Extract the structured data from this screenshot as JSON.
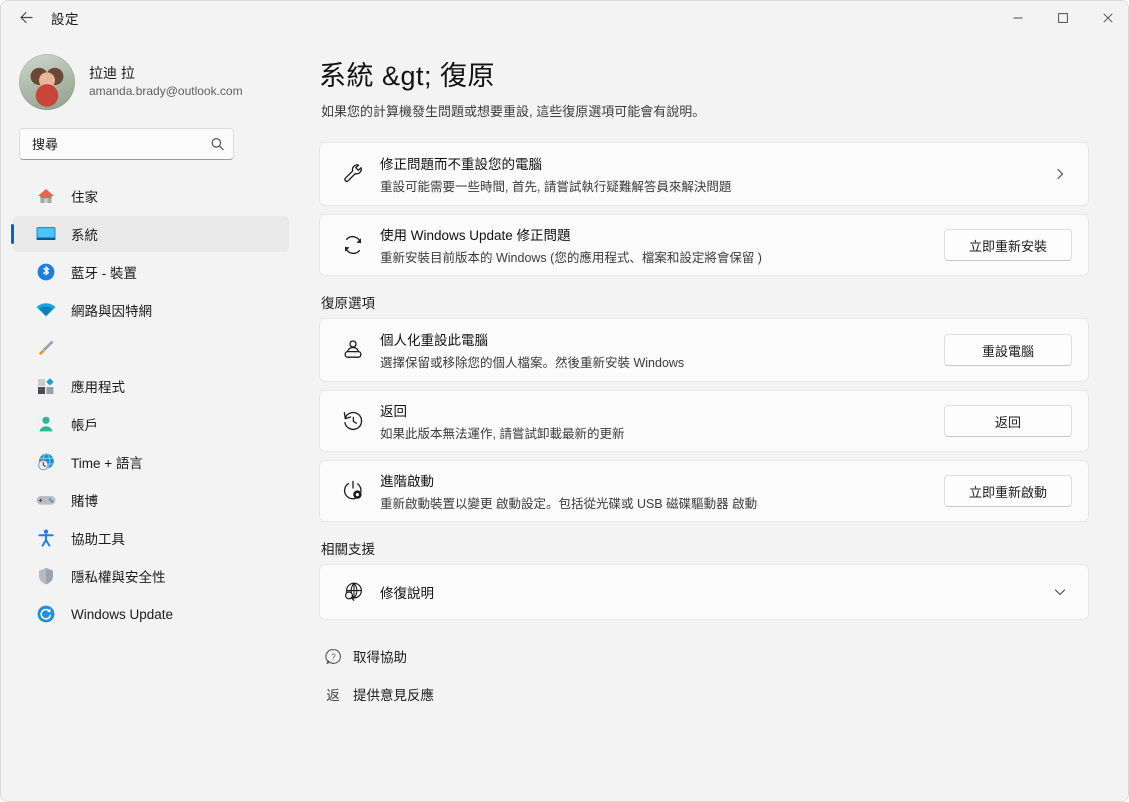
{
  "window": {
    "title": "設定",
    "back_icon": "arrow-left-icon",
    "controls": {
      "minimize": "─",
      "maximize": "□",
      "close": "✕"
    }
  },
  "sidebar": {
    "profile": {
      "name": "拉迪 拉",
      "email": "amanda.brady@outlook.com",
      "avatar": "user-avatar"
    },
    "search": {
      "placeholder": "搜尋",
      "value": "",
      "icon": "search-icon"
    },
    "items": [
      {
        "label": "住家",
        "icon": "home-icon",
        "selected": false
      },
      {
        "label": "系統",
        "icon": "monitor-icon",
        "selected": true
      },
      {
        "label": "藍牙 - 裝置",
        "icon": "bluetooth-icon",
        "selected": false
      },
      {
        "label": "網路與因特網",
        "icon": "wifi-icon",
        "selected": false
      },
      {
        "label": "",
        "icon": "paintbrush-icon",
        "selected": false
      },
      {
        "label": "應用程式",
        "icon": "apps-icon",
        "selected": false
      },
      {
        "label": "帳戶",
        "icon": "account-icon",
        "selected": false
      },
      {
        "label": "Time + 語言",
        "icon": "clock-globe-icon",
        "selected": false
      },
      {
        "label": "賭博",
        "icon": "gamepad-icon",
        "selected": false
      },
      {
        "label": "協助工具",
        "icon": "accessibility-icon",
        "selected": false
      },
      {
        "label": "隱私權與安全性",
        "icon": "shield-icon",
        "selected": false
      },
      {
        "label": "Windows Update",
        "icon": "update-icon",
        "selected": false
      }
    ]
  },
  "main": {
    "title": "系統 &gt;   復原",
    "subtitle": "如果您的計算機發生問題或想要重設, 這些復原選項可能會有說明。",
    "top_cards": [
      {
        "icon": "wrench-icon",
        "title": "修正問題而不重設您的電腦",
        "desc": "重設可能需要一些時間, 首先, 請嘗試執行疑難解答員來解決問題",
        "action_type": "chevron",
        "action_label": "›"
      },
      {
        "icon": "refresh-icon",
        "title": "使用 Windows Update 修正問題",
        "desc": "重新安裝目前版本的 Windows (您的應用程式、檔案和設定將會保留 )",
        "action_type": "button",
        "action_label": "立即重新安裝"
      }
    ],
    "recovery_section_label": "復原選項",
    "recovery_cards": [
      {
        "icon": "reset-pc-icon",
        "title": "個人化重設此電腦",
        "desc": "選擇保留或移除您的個人檔案。然後重新安裝 Windows",
        "action_type": "button",
        "action_label": "重設電腦"
      },
      {
        "icon": "history-icon",
        "title": "返回",
        "desc": "如果此版本無法運作, 請嘗試卸載最新的更新",
        "action_type": "button",
        "action_label": "返回"
      },
      {
        "icon": "power-gear-icon",
        "title": "進階啟動",
        "desc": "重新啟動裝置以變更 啟動設定。包括從光碟或 USB 磁碟驅動器 啟動",
        "action_type": "button",
        "action_label": "立即重新啟動"
      }
    ],
    "support_section_label": "相關支援",
    "support_card": {
      "icon": "globe-search-icon",
      "title": "修復說明",
      "action_type": "expand",
      "action_label": "⌄"
    },
    "links": [
      {
        "icon": "help-circle-icon",
        "icon_text": "",
        "label": "取得協助"
      },
      {
        "icon": "feedback-icon",
        "icon_text": "返",
        "label": "提供意見反應"
      }
    ]
  },
  "colors": {
    "page_bg": "#f3f3f3",
    "card_bg": "#fbfbfb",
    "accent": "#0067c0",
    "text": "#1b1b1b"
  }
}
